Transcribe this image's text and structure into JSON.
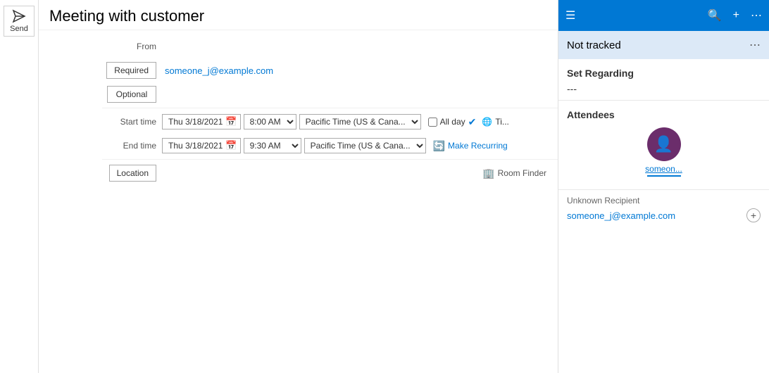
{
  "send_button": {
    "label": "Send"
  },
  "meeting": {
    "title": "Meeting with customer",
    "from_label": "From",
    "title_label": "Title"
  },
  "attendees_section": {
    "required_label": "Required",
    "optional_label": "Optional",
    "required_email": "someone_j@example.com",
    "optional_email": ""
  },
  "start_time": {
    "label": "Start time",
    "date": "Thu 3/18/2021",
    "time": "8:00 AM",
    "timezone": "Pacific Time (US & Cana...",
    "allday_label": "All day"
  },
  "end_time": {
    "label": "End time",
    "date": "Thu 3/18/2021",
    "time": "9:30 AM",
    "timezone": "Pacific Time (US & Cana..."
  },
  "recurring": {
    "label": "Make Recurring"
  },
  "location": {
    "label": "Location",
    "btn_label": "Location",
    "room_finder_label": "Room Finder"
  },
  "right_panel": {
    "not_tracked": "Not tracked",
    "set_regarding_label": "Set Regarding",
    "set_regarding_value": "---",
    "attendees_label": "Attendees",
    "attendee_name": "someon...",
    "unknown_recipient_label": "Unknown Recipient",
    "unknown_recipient_email": "someone_j@example.com"
  },
  "topbar": {
    "hamburger": "☰",
    "search": "🔍",
    "plus": "+",
    "more": "⋯"
  }
}
